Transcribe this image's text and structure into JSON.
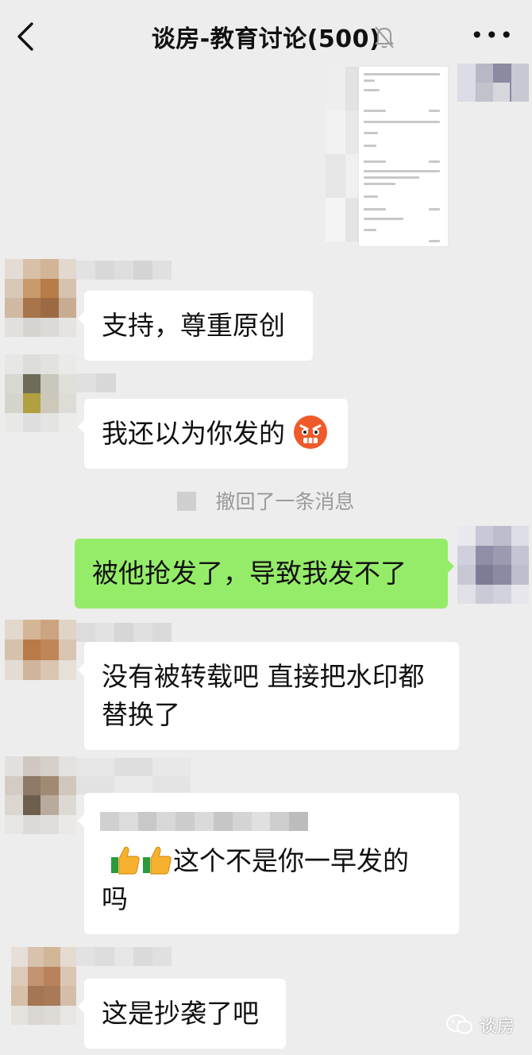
{
  "header": {
    "back_icon": "chevron-left-icon",
    "title": "谈房-教育讨论(500)",
    "mute_icon": "bell-muted-icon",
    "more_icon": "more-dots-icon"
  },
  "messages": [
    {
      "side": "right",
      "type": "image"
    },
    {
      "side": "left",
      "type": "text",
      "text": "支持，尊重原创"
    },
    {
      "side": "left",
      "type": "text",
      "text": "我还以为你发的",
      "emoji": "angry-face-icon"
    },
    {
      "side": "system",
      "type": "recall",
      "text": "撤回了一条消息"
    },
    {
      "side": "right",
      "type": "text",
      "text": "被他抢发了，导致我发不了"
    },
    {
      "side": "left",
      "type": "text",
      "text_line1": "没有被转载吧  直接把水印都",
      "text_line2": "替换了"
    },
    {
      "side": "left",
      "type": "text",
      "text_line1": "这个不是你一早发的",
      "text_line2": "吗",
      "emoji": "thumbs-up-icon"
    },
    {
      "side": "left",
      "type": "text",
      "text": "这是抄袭了吧"
    }
  ],
  "watermark": {
    "icon": "wechat-icon",
    "text": "谈房"
  },
  "colors": {
    "background": "#ededed",
    "my_bubble": "#95ec69",
    "their_bubble": "#ffffff"
  }
}
